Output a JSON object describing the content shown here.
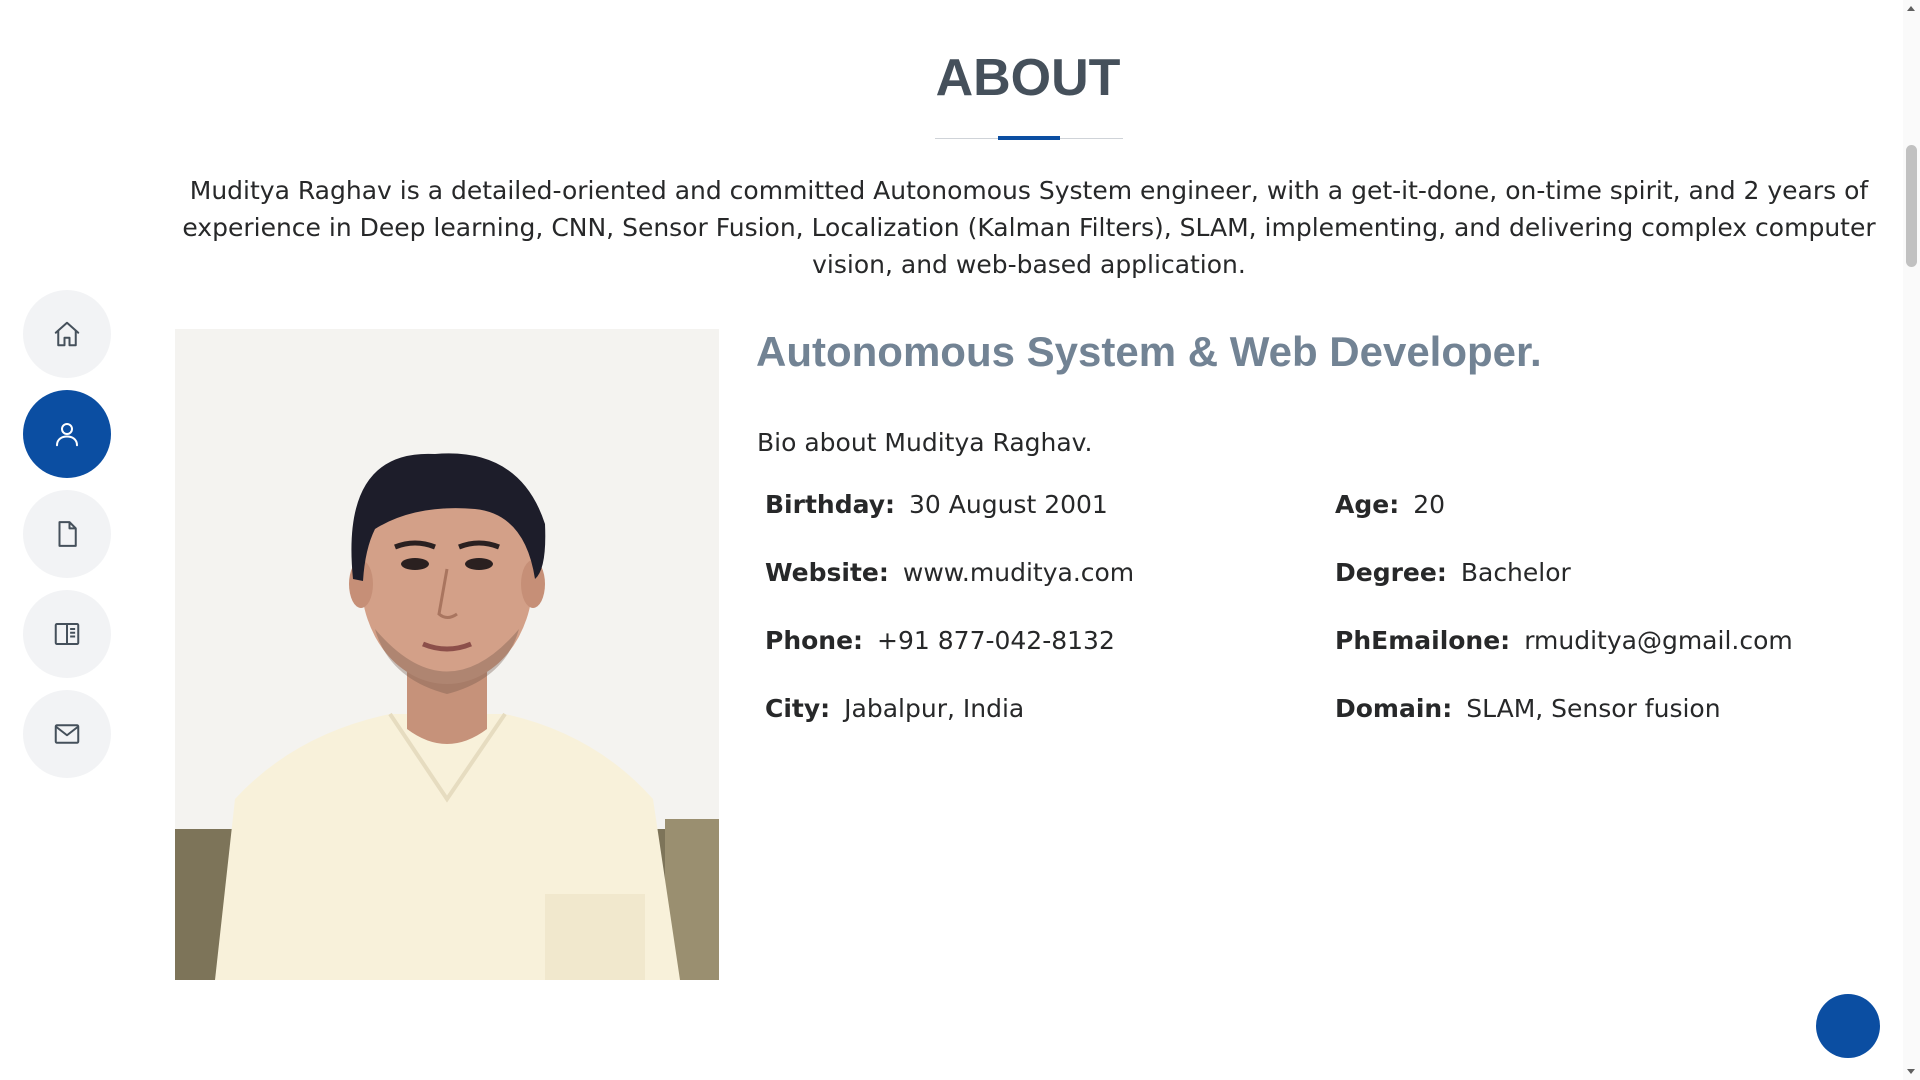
{
  "side_nav": {
    "items": [
      {
        "icon": "home-icon",
        "active": false
      },
      {
        "icon": "person-icon",
        "active": true
      },
      {
        "icon": "file-icon",
        "active": false
      },
      {
        "icon": "book-icon",
        "active": false
      },
      {
        "icon": "envelope-icon",
        "active": false
      }
    ]
  },
  "about": {
    "title": "ABOUT",
    "intro": "Muditya Raghav is a detailed-oriented and committed Autonomous System engineer, with a get-it-done, on-time spirit, and 2 years of experience in Deep learning, CNN, Sensor Fusion, Localization (Kalman Filters), SLAM, implementing, and delivering complex computer vision, and web-based application.",
    "role": "Autonomous System & Web Developer.",
    "bio": "Bio about Muditya Raghav.",
    "info": {
      "birthday_label": "Birthday:",
      "birthday": "30 August 2001",
      "age_label": "Age:",
      "age": "20",
      "website_label": "Website:",
      "website": "www.muditya.com",
      "degree_label": "Degree:",
      "degree": "Bachelor",
      "phone_label": "Phone:",
      "phone": "+91 877-042-8132",
      "email_label": "PhEmailone:",
      "email": "rmuditya@gmail.com",
      "city_label": "City:",
      "city": "Jabalpur, India",
      "domain_label": "Domain:",
      "domain": "SLAM, Sensor fusion"
    }
  },
  "colors": {
    "accent": "#0b4ea2",
    "heading": "#45505b",
    "subheading": "#728394",
    "text": "#272829",
    "nav_bg": "#f2f3f5"
  }
}
